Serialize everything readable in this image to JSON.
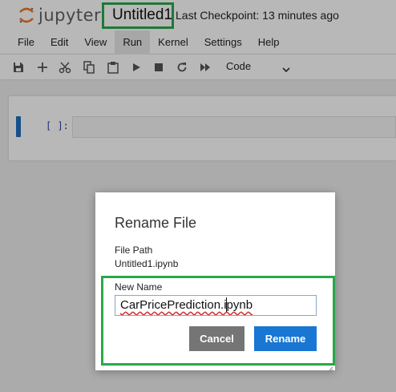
{
  "header": {
    "logo_text": "jupyter",
    "notebook_title": "Untitled1",
    "checkpoint": "Last Checkpoint: 13 minutes ago"
  },
  "menubar": {
    "items": [
      "File",
      "Edit",
      "View",
      "Run",
      "Kernel",
      "Settings",
      "Help"
    ],
    "active": "Run"
  },
  "toolbar": {
    "buttons": [
      "save-icon",
      "add-icon",
      "cut-icon",
      "copy-icon",
      "paste-icon",
      "run-icon",
      "stop-icon",
      "restart-icon",
      "fast-forward-icon"
    ],
    "cell_type": "Code"
  },
  "cell": {
    "prompt": "[ ]:"
  },
  "dialog": {
    "title": "Rename File",
    "file_path_label": "File Path",
    "file_path_value": "Untitled1.ipynb",
    "new_name_label": "New Name",
    "new_name_value": "CarPricePrediction.ipynb",
    "cancel_label": "Cancel",
    "rename_label": "Rename"
  },
  "colors": {
    "highlight": "#2aa84a",
    "primary_button": "#1976d2",
    "secondary_button": "#757575",
    "cell_active": "#1e6fc0"
  }
}
